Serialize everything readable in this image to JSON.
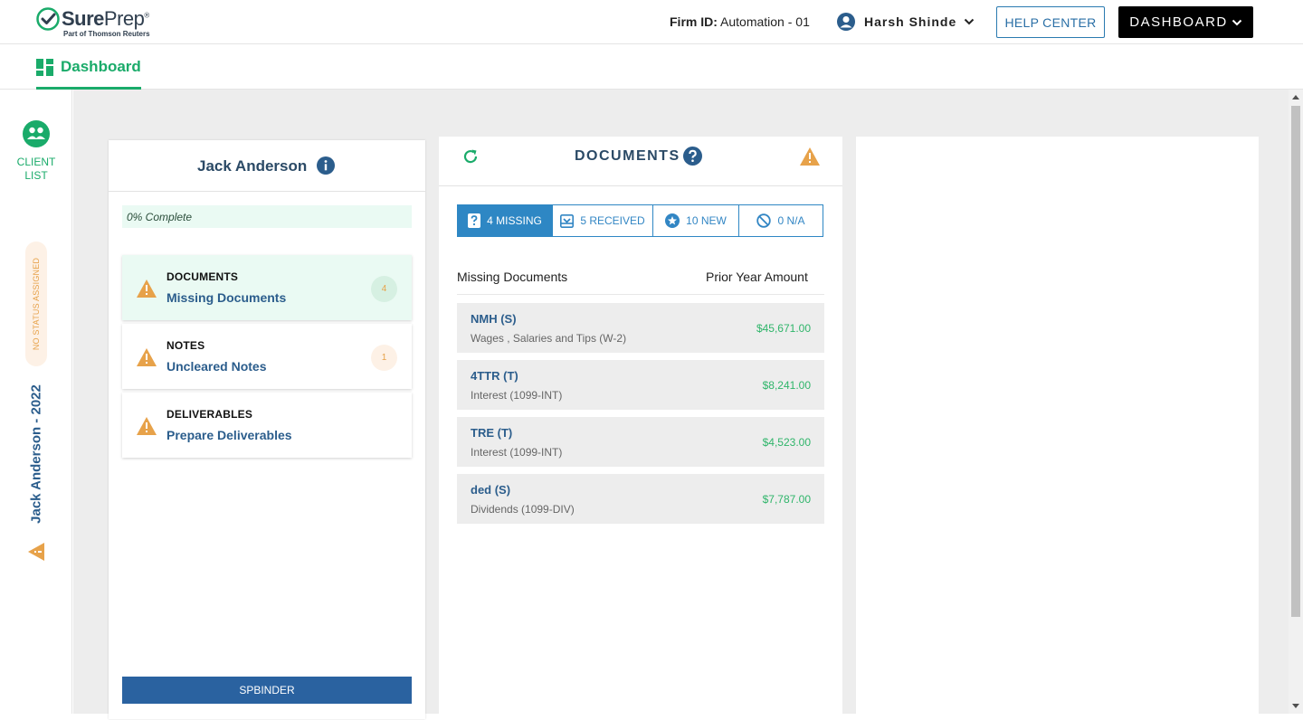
{
  "brand": {
    "name_bold": "Sure",
    "name_light": "Prep",
    "registered": "®",
    "subtitle": "Part of Thomson Reuters"
  },
  "header": {
    "firm_label": "Firm ID:",
    "firm_value": "Automation - 01",
    "user_name": "Harsh Shinde",
    "help_center": "HELP CENTER",
    "dashboard": "DASHBOARD"
  },
  "tabs": {
    "dashboard": "Dashboard"
  },
  "sidebar": {
    "client_list_1": "CLIENT",
    "client_list_2": "LIST",
    "status": "NO STATUS ASSIGNED",
    "client_year": "Jack Anderson - 2022"
  },
  "client_panel": {
    "name": "Jack Anderson",
    "progress": "0% Complete",
    "tasks": [
      {
        "title": "DOCUMENTS",
        "subtitle": "Missing Documents",
        "count": "4"
      },
      {
        "title": "NOTES",
        "subtitle": "Uncleared Notes",
        "count": "1"
      },
      {
        "title": "DELIVERABLES",
        "subtitle": "Prepare Deliverables"
      }
    ],
    "spbinder": "SPBINDER"
  },
  "documents_panel": {
    "title": "DOCUMENTS",
    "filters": [
      {
        "label": "4 MISSING",
        "icon": "question-doc-icon"
      },
      {
        "label": "5 RECEIVED",
        "icon": "inbox-icon"
      },
      {
        "label": "10 NEW",
        "icon": "star-icon"
      },
      {
        "label": "0 N/A",
        "icon": "ban-icon"
      }
    ],
    "col_missing": "Missing Documents",
    "col_amount": "Prior Year Amount",
    "rows": [
      {
        "name": "NMH (S)",
        "desc": "Wages , Salaries and Tips (W-2)",
        "amount": "$45,671.00"
      },
      {
        "name": "4TTR (T)",
        "desc": "Interest (1099-INT)",
        "amount": "$8,241.00"
      },
      {
        "name": "TRE (T)",
        "desc": "Interest (1099-INT)",
        "amount": "$4,523.00"
      },
      {
        "name": "ded (S)",
        "desc": "Dividends (1099-DIV)",
        "amount": "$7,787.00"
      }
    ]
  },
  "colors": {
    "brand_green": "#1aab6a",
    "navy": "#2b5d8c",
    "warning": "#e7a24a",
    "filter_blue": "#2e87c4",
    "amount_green": "#2fb56a"
  }
}
